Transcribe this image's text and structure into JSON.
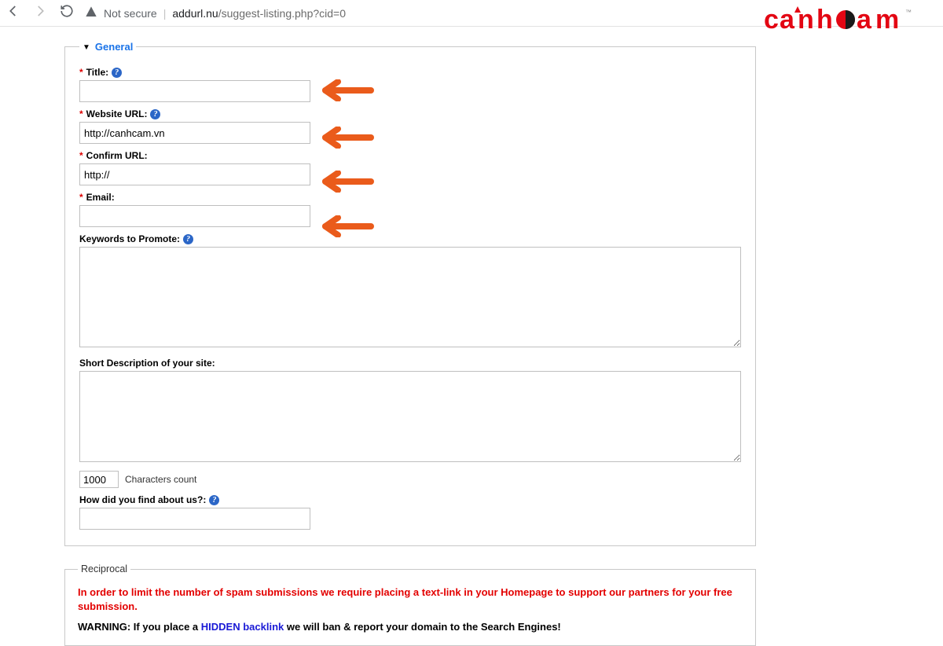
{
  "browser": {
    "not_secure": "Not secure",
    "host": "addurl.nu",
    "path": "/suggest-listing.php?cid=0"
  },
  "watermark": {
    "text": "canheam"
  },
  "form": {
    "legend": "General",
    "title": {
      "label": "Title:",
      "value": ""
    },
    "website_url": {
      "label": "Website URL:",
      "value": "http://canhcam.vn"
    },
    "confirm_url": {
      "label": "Confirm URL:",
      "value": "http://"
    },
    "email": {
      "label": "Email:",
      "value": ""
    },
    "keywords": {
      "label": "Keywords to Promote:",
      "value": ""
    },
    "description": {
      "label": "Short Description of your site:",
      "value": ""
    },
    "char_count": {
      "value": "1000",
      "label": "Characters count"
    },
    "how_find": {
      "label": "How did you find about us?:",
      "value": ""
    }
  },
  "reciprocal": {
    "legend": "Reciprocal",
    "notice": "In order to limit the number of spam submissions we require placing a text-link in your Homepage to support our partners for your free submission.",
    "warning_head": "WARNING:",
    "warning_mid": " If you place a ",
    "warning_hidden": "HIDDEN backlink",
    "warning_tail": " we will ban & report your domain to the Search Engines!"
  }
}
